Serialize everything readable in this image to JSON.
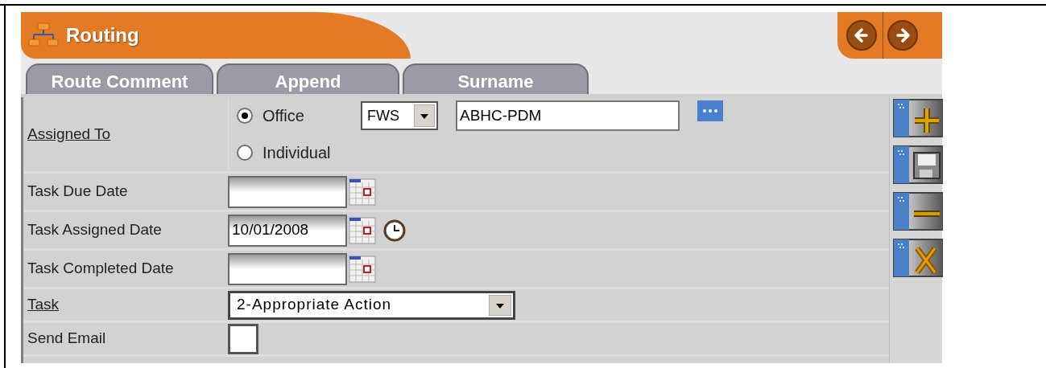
{
  "header": {
    "title": "Routing"
  },
  "nav": [
    {
      "kind": "back"
    },
    {
      "kind": "forward"
    }
  ],
  "tabs": [
    {
      "label": "Route Comment",
      "selected": false
    },
    {
      "label": "Append",
      "selected": false
    },
    {
      "label": "Surname",
      "selected": false
    }
  ],
  "form": [
    {
      "kind": "assignee",
      "label": "Assigned To",
      "link": true,
      "options": [
        {
          "label": "Office",
          "selected": true
        },
        {
          "label": "Individual",
          "selected": false
        }
      ],
      "agency": "FWS",
      "office": "ABHC-PDM"
    },
    {
      "kind": "date",
      "label": "Task Due Date",
      "link": false,
      "clock": false
    },
    {
      "kind": "date",
      "label": "Task Assigned Date",
      "link": false,
      "value": "10/01/2008",
      "clock": true
    },
    {
      "kind": "date",
      "label": "Task Completed Date",
      "link": false,
      "clock": false
    },
    {
      "kind": "select",
      "label": "Task",
      "link": true,
      "value": "2-Appropriate Action"
    },
    {
      "kind": "checkbox",
      "label": "Send Email",
      "link": false,
      "checked": false
    }
  ],
  "toolbar": [
    {
      "kind": "add"
    },
    {
      "kind": "save"
    },
    {
      "kind": "remove"
    },
    {
      "kind": "delete"
    }
  ]
}
